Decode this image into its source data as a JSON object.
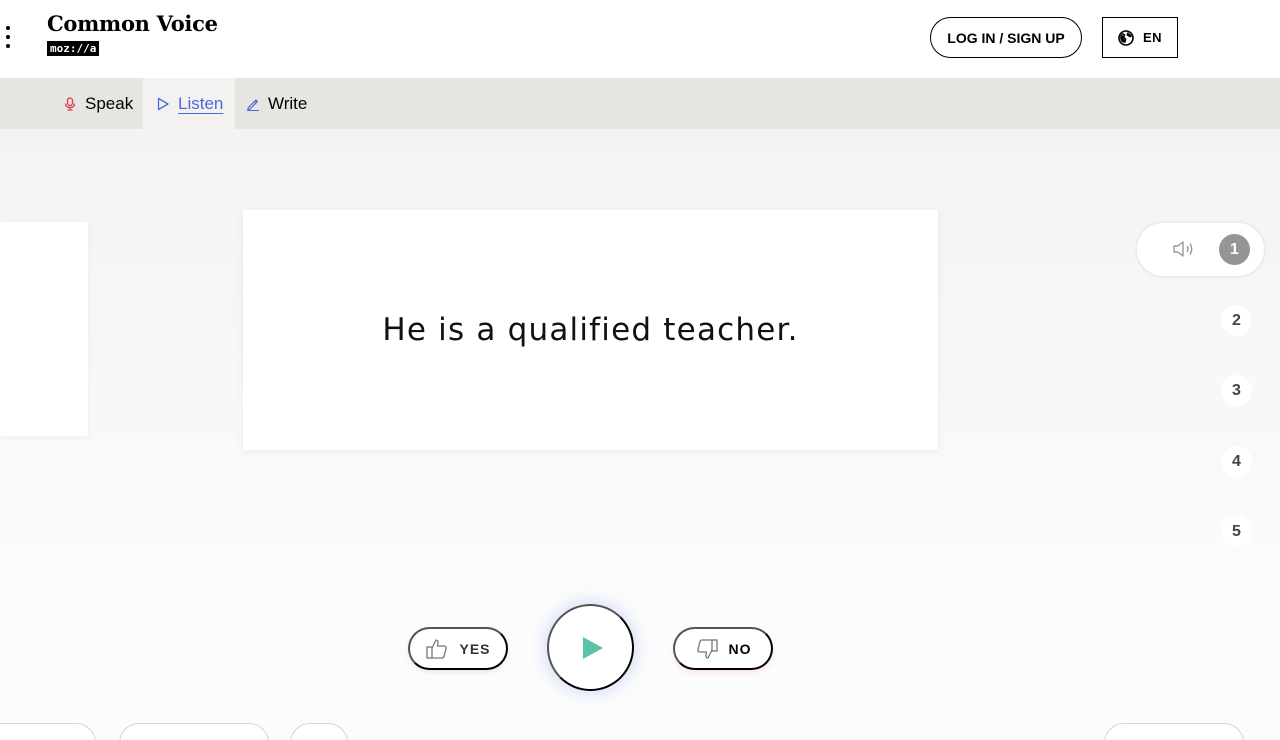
{
  "header": {
    "brand_title": "Common Voice",
    "brand_badge": "moz://a",
    "menu_icon": "kebab-menu-icon",
    "login_label": "LOG IN / SIGN UP",
    "language_label": "EN",
    "language_icon": "globe-icon"
  },
  "nav": {
    "items": [
      {
        "label": "Speak",
        "icon": "microphone-icon",
        "active": false
      },
      {
        "label": "Listen",
        "icon": "play-outline-icon",
        "active": true
      },
      {
        "label": "Write",
        "icon": "pencil-icon",
        "active": false
      }
    ]
  },
  "main": {
    "sentence": "He is a qualified teacher."
  },
  "progress": {
    "icon": "speaker-icon",
    "steps": [
      "1",
      "2",
      "3",
      "4",
      "5"
    ],
    "current_step": 1
  },
  "actions": {
    "yes_label": "YES",
    "no_label": "NO",
    "yes_icon": "thumbs-up-icon",
    "no_icon": "thumbs-down-icon",
    "play_icon": "play-icon"
  },
  "colors": {
    "accent_blue": "#4a69dd",
    "mic_red": "#e03a4f",
    "play_green": "#5bc3a8",
    "nav_bg": "#e7e5e2"
  }
}
